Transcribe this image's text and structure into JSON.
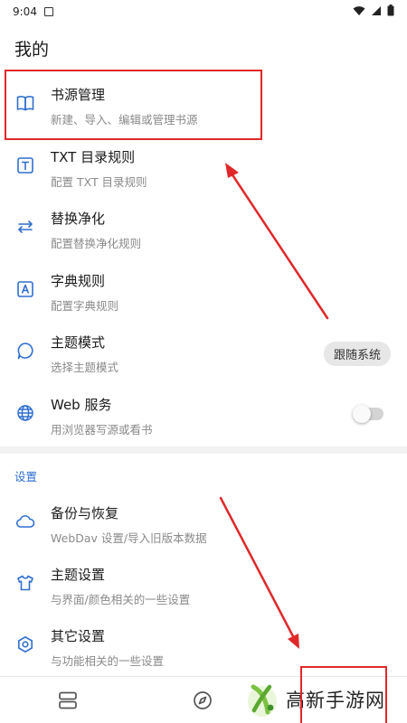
{
  "status_bar": {
    "time": "9:04"
  },
  "page_title": "我的",
  "items": [
    {
      "title": "书源管理",
      "subtitle": "新建、导入、编辑或管理书源",
      "icon": "book-open-icon"
    },
    {
      "title": "TXT 目录规则",
      "subtitle": "配置 TXT 目录规则",
      "icon": "text-box-icon"
    },
    {
      "title": "替换净化",
      "subtitle": "配置替换净化规则",
      "icon": "swap-arrows-icon"
    },
    {
      "title": "字典规则",
      "subtitle": "配置字典规则",
      "icon": "dictionary-icon"
    },
    {
      "title": "主题模式",
      "subtitle": "选择主题模式",
      "icon": "theme-bubble-icon"
    },
    {
      "title": "Web 服务",
      "subtitle": "用浏览器写源或看书",
      "icon": "globe-icon"
    }
  ],
  "theme_mode_value": "跟随系统",
  "web_service_enabled": false,
  "settings_section_label": "设置",
  "settings_items": [
    {
      "title": "备份与恢复",
      "subtitle": "WebDav 设置/导入旧版本数据",
      "icon": "cloud-icon"
    },
    {
      "title": "主题设置",
      "subtitle": "与界面/颜色相关的一些设置",
      "icon": "tshirt-icon"
    },
    {
      "title": "其它设置",
      "subtitle": "与功能相关的一些设置",
      "icon": "settings-hex-icon"
    }
  ],
  "bottom_nav": {
    "icons": [
      "bookshelf-icon",
      "compass-icon"
    ]
  },
  "watermark": {
    "text": "高新手游网"
  },
  "colors": {
    "accent": "#2f6fcf",
    "annotation": "#e0282a"
  }
}
